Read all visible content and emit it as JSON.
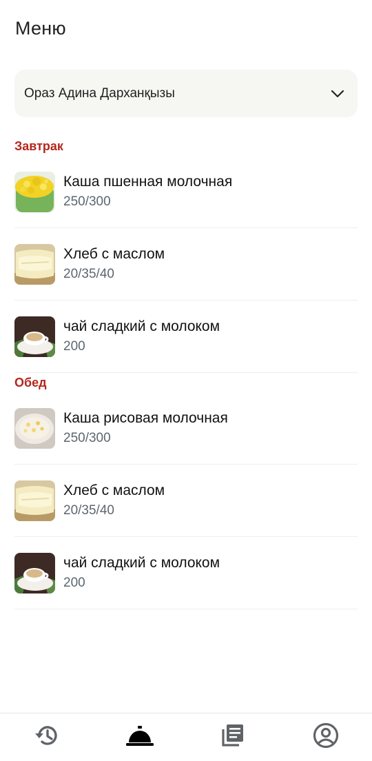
{
  "header": {
    "title": "Меню"
  },
  "student_selector": {
    "value": "Ораз Адина Дарханқызы",
    "icon": "chevron-down-icon"
  },
  "sections": [
    {
      "title": "Завтрак",
      "items": [
        {
          "name": "Каша пшенная молочная",
          "portion": "250/300",
          "image": "millet-porridge"
        },
        {
          "name": "Хлеб с маслом",
          "portion": "20/35/40",
          "image": "bread-butter"
        },
        {
          "name": "чай сладкий с молоком",
          "portion": "200",
          "image": "tea-milk"
        }
      ]
    },
    {
      "title": "Обед",
      "items": [
        {
          "name": "Каша рисовая молочная",
          "portion": "250/300",
          "image": "rice-porridge"
        },
        {
          "name": "Хлеб с маслом",
          "portion": "20/35/40",
          "image": "bread-butter"
        },
        {
          "name": "чай сладкий с молоком",
          "portion": "200",
          "image": "tea-milk"
        }
      ]
    }
  ],
  "bottom_nav": [
    {
      "icon": "history-icon",
      "active": false
    },
    {
      "icon": "service-bell-icon",
      "active": true
    },
    {
      "icon": "menu-list-icon",
      "active": false
    },
    {
      "icon": "account-icon",
      "active": false
    }
  ],
  "colors": {
    "section_title": "#b3261e",
    "portion_text": "#5c6670",
    "selector_bg": "#f6f6f3",
    "nav_icon": "#5f6368"
  }
}
